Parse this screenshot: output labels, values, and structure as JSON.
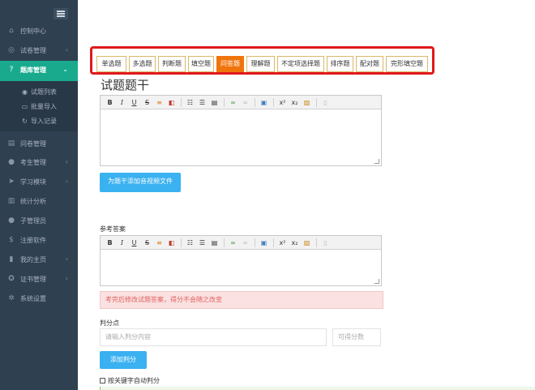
{
  "sidebar": {
    "items": [
      {
        "label": "控制中心",
        "icon": "home-icon"
      },
      {
        "label": "试卷管理",
        "icon": "check-circle-icon"
      },
      {
        "label": "题库管理",
        "icon": "question-circle-icon"
      },
      {
        "label": "问卷管理",
        "icon": "document-icon"
      },
      {
        "label": "考生管理",
        "icon": "user-icon"
      },
      {
        "label": "学习模块",
        "icon": "paper-plane-icon"
      },
      {
        "label": "统计分析",
        "icon": "bar-chart-icon"
      },
      {
        "label": "子管理员",
        "icon": "user-icon"
      },
      {
        "label": "注册软件",
        "icon": "dollar-icon"
      },
      {
        "label": "我的主页",
        "icon": "book-icon"
      },
      {
        "label": "证书管理",
        "icon": "certificate-icon"
      },
      {
        "label": "系统设置",
        "icon": "gear-icon"
      }
    ],
    "subitems": [
      {
        "label": "试题列表",
        "icon": "list-icon"
      },
      {
        "label": "批量导入",
        "icon": "import-icon"
      },
      {
        "label": "导入记录",
        "icon": "history-icon"
      }
    ]
  },
  "question_types": [
    "单选题",
    "多选题",
    "判断题",
    "填空题",
    "问答题",
    "理解题",
    "不定项选择题",
    "排序题",
    "配对题",
    "完形填空题"
  ],
  "selected_type": "问答题",
  "stem": {
    "title": "试题题干",
    "add_media_label": "为题干添加音视频文件"
  },
  "answer": {
    "label": "参考答案",
    "warning": "考完后修改试题答案，得分不会随之改变"
  },
  "scoring": {
    "label": "判分点",
    "content_placeholder": "请输入判分内容",
    "score_placeholder": "可得分数",
    "add_label": "添加判分",
    "keyword_label": "按关键字自动判分"
  },
  "colors": {
    "sidebar_bg": "#2f4050",
    "active_nav": "#19aa8d",
    "selected_type": "#f0740c",
    "primary_button": "#3ab1f0",
    "highlight_border": "#e0191c"
  }
}
